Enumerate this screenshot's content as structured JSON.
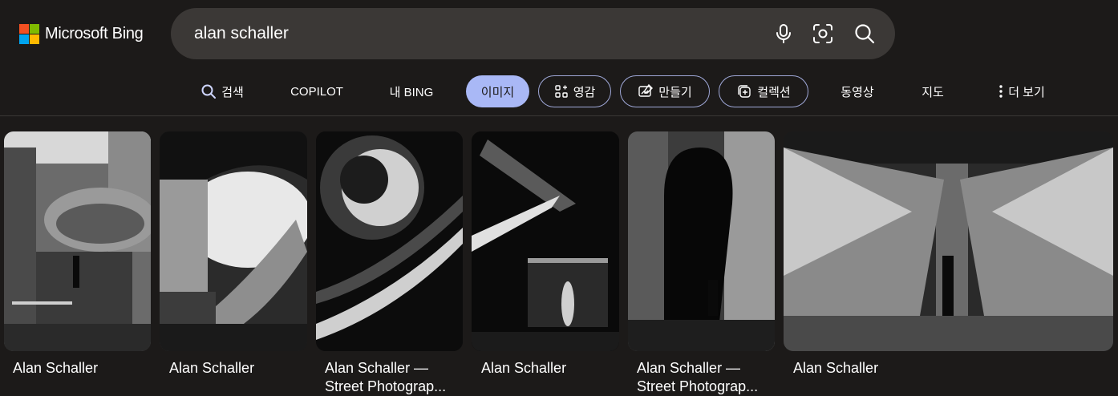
{
  "colors": {
    "background": "#1c1a19",
    "search_box": "#3b3836",
    "active_tab": "#a9b8f6",
    "pill_border": "#9fa8d8",
    "ms_red": "#f25022",
    "ms_green": "#7fba00",
    "ms_blue": "#00a4ef",
    "ms_yellow": "#ffb900"
  },
  "header": {
    "logo_text": "Microsoft Bing",
    "search_query": "alan schaller",
    "icons": [
      "microphone-icon",
      "visual-search-icon",
      "search-icon"
    ]
  },
  "nav": {
    "items": [
      {
        "label": "검색",
        "icon": "search-icon"
      },
      {
        "label": "COPILOT"
      },
      {
        "label": "내 BING"
      },
      {
        "label": "이미지",
        "active": true
      },
      {
        "label": "영감",
        "icon": "inspiration-icon"
      },
      {
        "label": "만들기",
        "icon": "create-icon"
      },
      {
        "label": "컬렉션",
        "icon": "collection-icon"
      },
      {
        "label": "동영상"
      },
      {
        "label": "지도"
      },
      {
        "label": "더 보기",
        "icon": "more-vertical-icon"
      }
    ]
  },
  "results": [
    {
      "title_line1": "Alan Schaller",
      "title_line2": ""
    },
    {
      "title_line1": "Alan Schaller",
      "title_line2": ""
    },
    {
      "title_line1": "Alan Schaller —",
      "title_line2": "Street Photograp..."
    },
    {
      "title_line1": "Alan Schaller",
      "title_line2": ""
    },
    {
      "title_line1": "Alan Schaller —",
      "title_line2": "Street Photograp..."
    },
    {
      "title_line1": "Alan Schaller",
      "title_line2": ""
    }
  ]
}
